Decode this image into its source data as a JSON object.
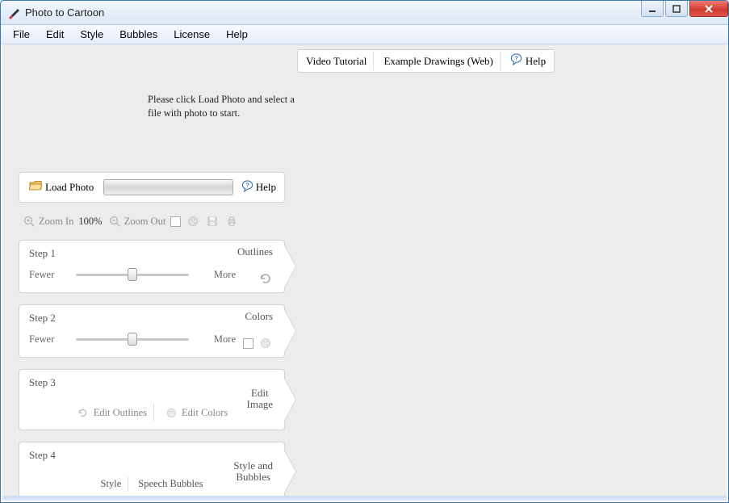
{
  "window": {
    "title": "Photo to Cartoon"
  },
  "menu": {
    "file": "File",
    "edit": "Edit",
    "style": "Style",
    "bubbles": "Bubbles",
    "license": "License",
    "help": "Help"
  },
  "toplinks": {
    "video": "Video Tutorial",
    "examples": "Example Drawings (Web)",
    "help": "Help"
  },
  "instruction": "Please click Load Photo and select a file with photo to start.",
  "load": {
    "button": "Load Photo",
    "help": "Help"
  },
  "zoom": {
    "in": "Zoom In",
    "pct": "100%",
    "out": "Zoom Out"
  },
  "steps": {
    "s1": {
      "title": "Step 1",
      "right": "Outlines",
      "low": "Fewer",
      "high": "More"
    },
    "s2": {
      "title": "Step 2",
      "right": "Colors",
      "low": "Fewer",
      "high": "More"
    },
    "s3": {
      "title": "Step 3",
      "rightA": "Edit",
      "rightB": "Image",
      "btn1": "Edit Outlines",
      "btn2": "Edit Colors"
    },
    "s4": {
      "title": "Step 4",
      "rightA": "Style and",
      "rightB": "Bubbles",
      "btn1": "Style",
      "btn2": "Speech Bubbles"
    }
  }
}
